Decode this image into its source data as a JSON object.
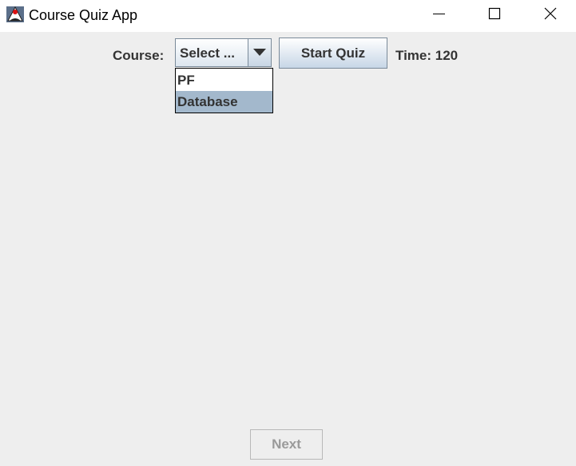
{
  "window": {
    "title": "Course Quiz App",
    "app_icon": "java-duke-icon",
    "controls": [
      "minimize-icon",
      "maximize-icon",
      "close-icon"
    ]
  },
  "toolbar": {
    "course_label": "Course:",
    "course_select": {
      "selected": "Select ...",
      "options": [
        "PF",
        "Database"
      ],
      "highlighted_option": "Database"
    },
    "start_button_label": "Start Quiz",
    "time_label": "Time: 120"
  },
  "footer": {
    "next_button_label": "Next",
    "next_enabled": false
  },
  "colors": {
    "window_background": "#eeeeee",
    "selection_highlight": "#a3b8cc",
    "text": "#333333",
    "disabled_text": "#9a9a9a"
  }
}
